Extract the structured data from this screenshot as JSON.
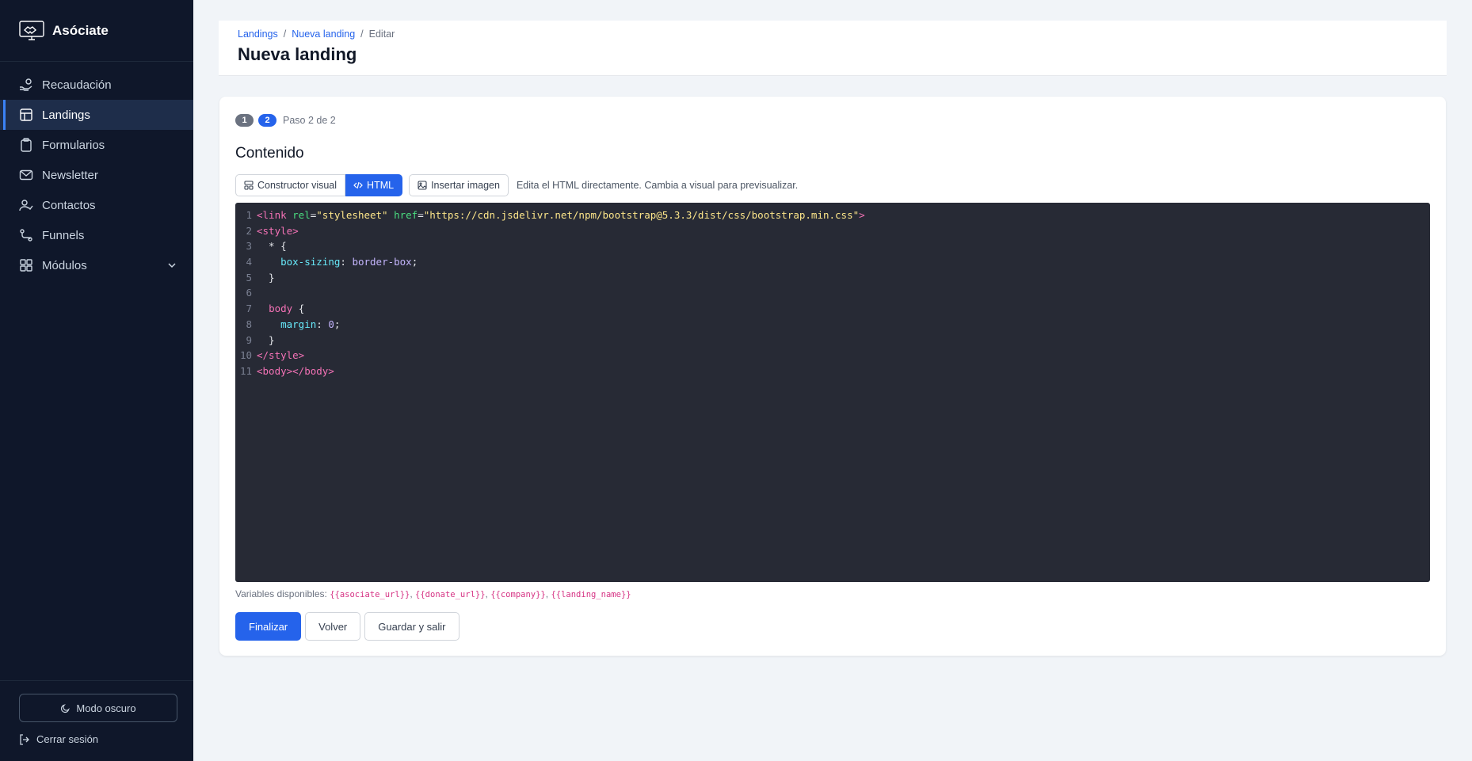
{
  "app": {
    "name": "Asóciate"
  },
  "sidebar": {
    "items": [
      {
        "label": "Recaudación",
        "icon": "hand-coin-icon"
      },
      {
        "label": "Landings",
        "icon": "layout-icon"
      },
      {
        "label": "Formularios",
        "icon": "clipboard-icon"
      },
      {
        "label": "Newsletter",
        "icon": "mail-icon"
      },
      {
        "label": "Contactos",
        "icon": "user-check-icon"
      },
      {
        "label": "Funnels",
        "icon": "route-icon"
      },
      {
        "label": "Módulos",
        "icon": "grid-icon"
      }
    ],
    "dark_mode_label": "Modo oscuro",
    "logout_label": "Cerrar sesión"
  },
  "header": {
    "breadcrumb": [
      "Landings",
      "Nueva landing",
      "Editar"
    ],
    "title": "Nueva landing"
  },
  "wizard": {
    "step_done": "1",
    "step_current": "2",
    "step_text": "Paso 2 de 2"
  },
  "content": {
    "title": "Contenido",
    "toolbar": {
      "visual_label": "Constructor visual",
      "html_label": "HTML",
      "insert_image_label": "Insertar imagen",
      "hint": "Edita el HTML directamente. Cambia a visual para previsualizar."
    },
    "variables_label": "Variables disponibles:",
    "variables": [
      "{{asociate_url}}",
      "{{donate_url}}",
      "{{company}}",
      "{{landing_name}}"
    ]
  },
  "actions": {
    "finish": "Finalizar",
    "back": "Volver",
    "save_exit": "Guardar y salir"
  },
  "code": {
    "lines": [
      [
        [
          "tag",
          "<link "
        ],
        [
          "attr",
          "rel"
        ],
        [
          "plain",
          "="
        ],
        [
          "str",
          "\"stylesheet\""
        ],
        [
          "plain",
          " "
        ],
        [
          "attr",
          "href"
        ],
        [
          "plain",
          "="
        ],
        [
          "str",
          "\"https://cdn.jsdelivr.net/npm/bootstrap@5.3.3/dist/css/bootstrap.min.css\""
        ],
        [
          "tag",
          ">"
        ]
      ],
      [
        [
          "tag",
          "<style>"
        ]
      ],
      [
        [
          "plain",
          "  * {"
        ]
      ],
      [
        [
          "plain",
          "    "
        ],
        [
          "prop",
          "box-sizing"
        ],
        [
          "plain",
          ": "
        ],
        [
          "val",
          "border-box"
        ],
        [
          "plain",
          ";"
        ]
      ],
      [
        [
          "plain",
          "  }"
        ]
      ],
      [],
      [
        [
          "plain",
          "  "
        ],
        [
          "tag",
          "body"
        ],
        [
          "plain",
          " {"
        ]
      ],
      [
        [
          "plain",
          "    "
        ],
        [
          "prop",
          "margin"
        ],
        [
          "plain",
          ": "
        ],
        [
          "val",
          "0"
        ],
        [
          "plain",
          ";"
        ]
      ],
      [
        [
          "plain",
          "  }"
        ]
      ],
      [
        [
          "tag",
          "</style>"
        ]
      ],
      [
        [
          "tag",
          "<body></body>"
        ]
      ]
    ]
  },
  "colors": {
    "sidebar_bg": "#0f172a",
    "accent": "#2563eb",
    "editor_bg": "#272a35"
  }
}
